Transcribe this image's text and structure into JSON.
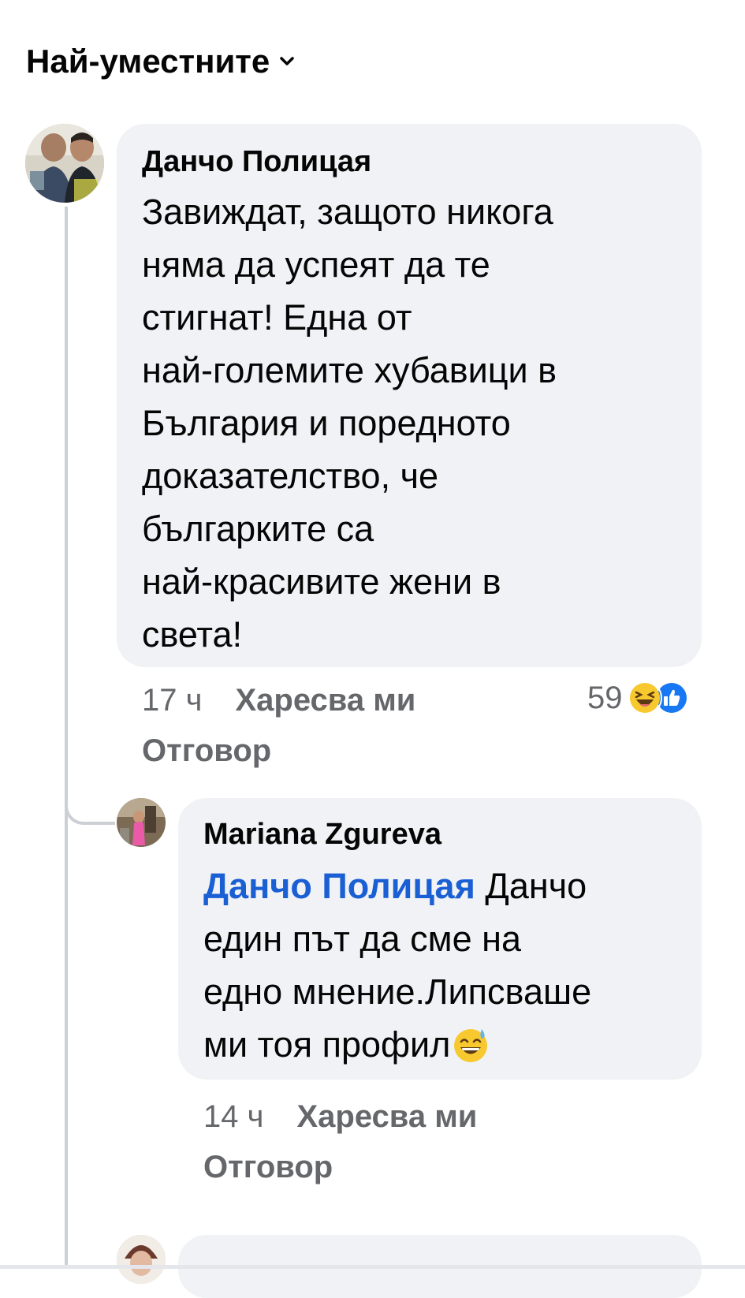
{
  "sort": {
    "label": "Най-уместните"
  },
  "comments": [
    {
      "author": "Данчо Полицая",
      "text_lines": [
        "Завиждат, защото никога",
        "няма да успеят да те",
        "стигнат! Една от",
        "най-големите хубавици в",
        "България и поредното",
        "доказателство, че",
        "българките са",
        "най-красивите жени в",
        "света!"
      ],
      "time": "17 ч",
      "like_label": "Харесва ми",
      "reply_label": "Отговор",
      "reaction_count": "59",
      "reaction_icons": [
        "laughing-emoji-icon",
        "like-thumb-icon"
      ]
    }
  ],
  "replies": [
    {
      "author": "Mariana Zgureva",
      "mention": "Данчо Полицая",
      "text_lines": [
        " Данчо",
        "един път да сме на",
        "едно мнение.Липсваше",
        "ми тоя профил"
      ],
      "trailing_emoji": "grinning-sweat-emoji-icon",
      "time": "14 ч",
      "like_label": "Харесва ми",
      "reply_label": "Отговор"
    }
  ],
  "colors": {
    "bubble": "#f0f2f5",
    "mention": "#1b5fd4",
    "meta": "#65676b",
    "like_blue": "#1877f2"
  }
}
